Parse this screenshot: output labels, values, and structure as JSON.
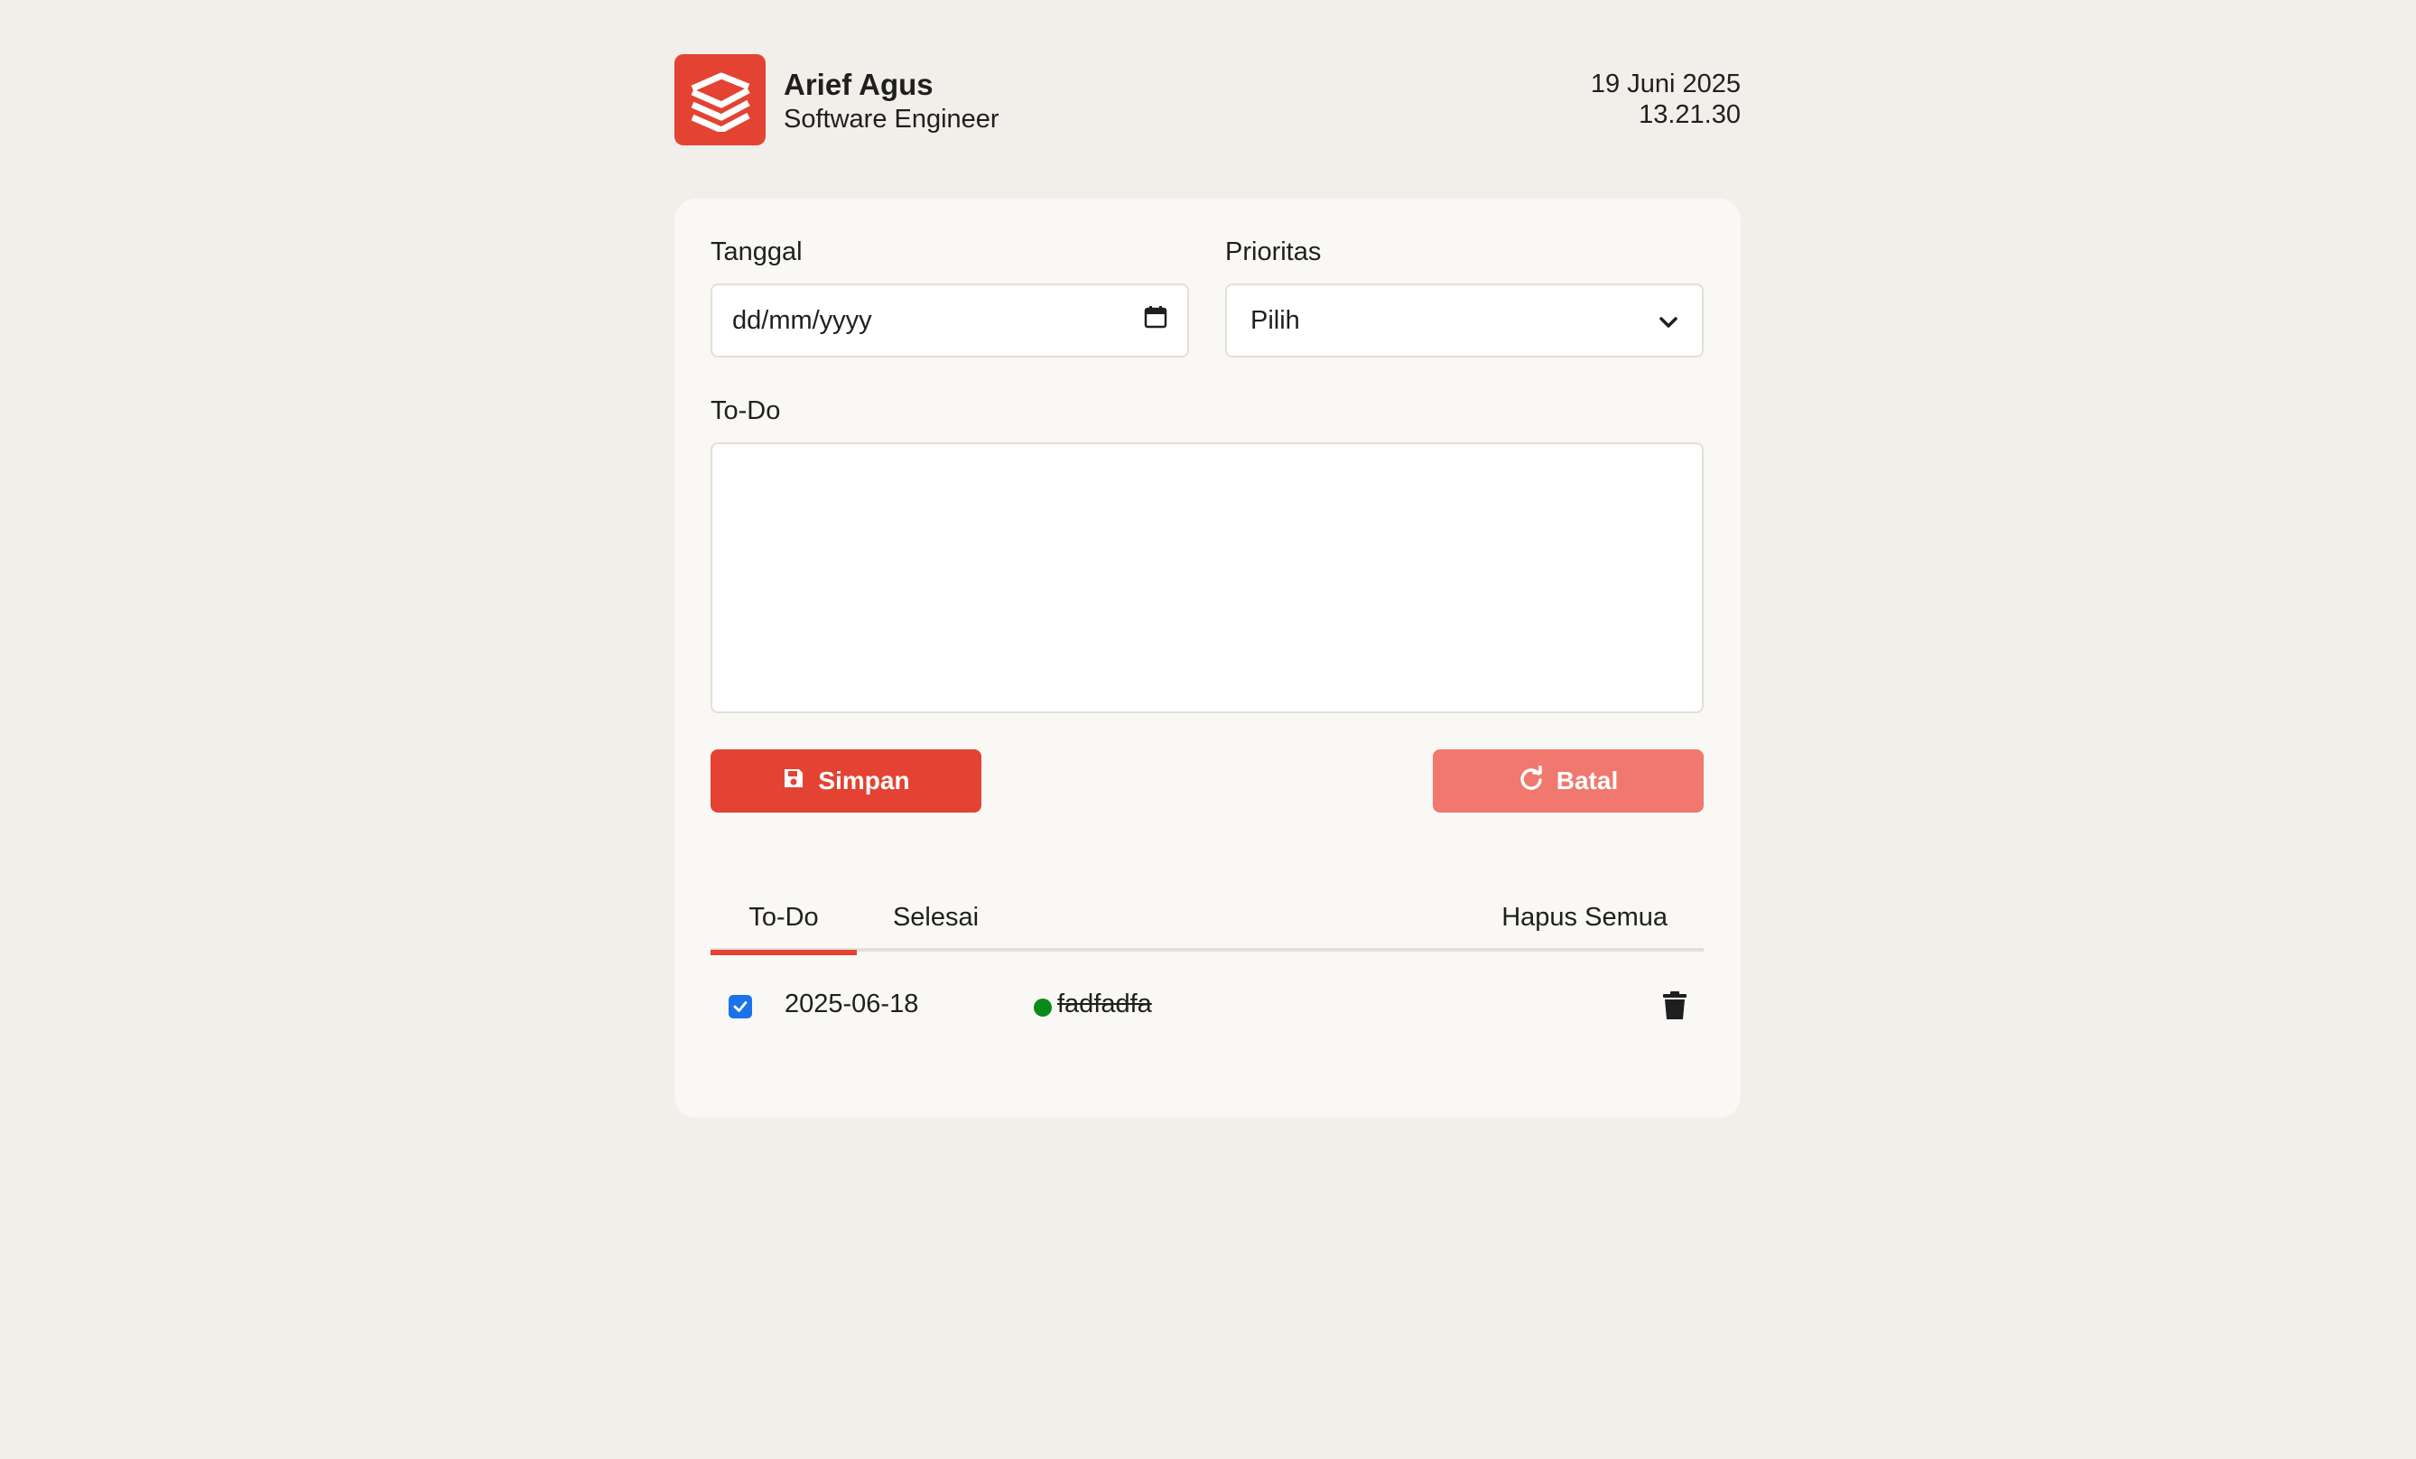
{
  "header": {
    "user_name": "Arief Agus",
    "user_role": "Software Engineer",
    "date": "19 Juni 2025",
    "time": "13.21.30"
  },
  "form": {
    "date_label": "Tanggal",
    "date_placeholder": "dd/mm/yyyy",
    "priority_label": "Prioritas",
    "priority_selected": "Pilih",
    "todo_label": "To-Do",
    "todo_value": "",
    "save_label": "Simpan",
    "cancel_label": "Batal"
  },
  "tabs": {
    "todo": "To-Do",
    "done": "Selesai",
    "clear_all": "Hapus Semua"
  },
  "items": [
    {
      "date": "2025-06-18",
      "text": "fadfadfa",
      "checked": true,
      "priority_color": "#0a8a1a"
    }
  ],
  "colors": {
    "accent": "#e44232",
    "accent_light": "#f0786e",
    "checkbox": "#1a73e8",
    "priority_green": "#0a8a1a"
  }
}
